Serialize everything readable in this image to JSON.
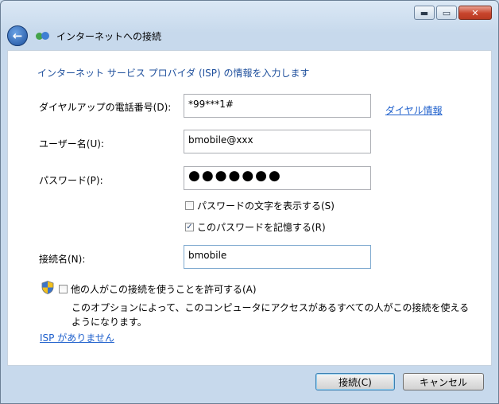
{
  "window": {
    "title": "インターネットへの接続",
    "min_glyph": "▬",
    "max_glyph": "▭",
    "close_glyph": "✕"
  },
  "back_glyph": "←",
  "heading": "インターネット サービス プロバイダ (ISP) の情報を入力します",
  "fields": {
    "phone_label": "ダイヤルアップの電話番号(D):",
    "phone_value": "*99***1#",
    "dial_info_link": "ダイヤル情報",
    "user_label": "ユーザー名(U):",
    "user_value": "bmobile@xxx",
    "password_label": "パスワード(P):",
    "password_value": "●●●●●●●",
    "show_chars_label": "パスワードの文字を表示する(S)",
    "show_chars_checked": false,
    "remember_label": "このパスワードを記憶する(R)",
    "remember_checked": true,
    "conn_name_label": "接続名(N):",
    "conn_name_value": "bmobile"
  },
  "allow_others": {
    "label": "他の人がこの接続を使うことを許可する(A)",
    "checked": false,
    "description": "このオプションによって、このコンピュータにアクセスがあるすべての人がこの接続を使えるようになります。"
  },
  "no_isp_link": "ISP がありません",
  "buttons": {
    "connect": "接続(C)",
    "cancel": "キャンセル"
  },
  "checkmark": "✓",
  "colors": {
    "heading": "#1e4f9c",
    "link": "#1d5fcc",
    "close_button": "#c8442c"
  }
}
